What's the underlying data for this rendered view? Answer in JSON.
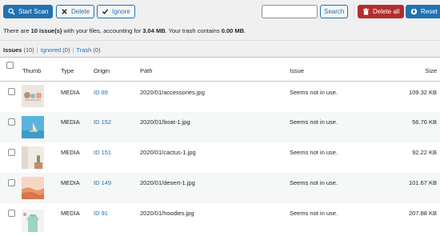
{
  "toolbar": {
    "start_scan_label": "Start Scan",
    "delete_label": "Delete",
    "ignore_label": "Ignore",
    "search_value": "",
    "search_button_label": "Search",
    "delete_all_label": "Delete all",
    "reset_label": "Reset"
  },
  "summary": {
    "prefix": "There are ",
    "issue_count": "10 issue(s)",
    "middle": " with your files, accounting for ",
    "size": "3.04 MB",
    "trash_text": ". Your trash contains ",
    "trash_size": "0.00 MB",
    "suffix": "."
  },
  "filters": {
    "issues_label": "Issues",
    "issues_count": "(10)",
    "ignored_label": "Ignored",
    "ignored_count": "(0)",
    "trash_label": "Trash",
    "trash_count": "(0)",
    "separator": "|"
  },
  "table": {
    "headers": {
      "thumb": "Thumb",
      "type": "Type",
      "origin": "Origin",
      "path": "Path",
      "issue": "Issue",
      "size": "Size"
    },
    "rows": [
      {
        "type": "MEDIA",
        "origin": "ID 89",
        "path": "2020/01/accessories.jpg",
        "issue": "Seems not in use.",
        "size": "109.32 KB",
        "thumb_icon": "accessories-thumbnail"
      },
      {
        "type": "MEDIA",
        "origin": "ID 152",
        "path": "2020/01/boat-1.jpg",
        "issue": "Seems not in use.",
        "size": "56.76 KB",
        "thumb_icon": "boat-thumbnail"
      },
      {
        "type": "MEDIA",
        "origin": "ID 151",
        "path": "2020/01/cactus-1.jpg",
        "issue": "Seems not in use.",
        "size": "92.22 KB",
        "thumb_icon": "cactus-thumbnail"
      },
      {
        "type": "MEDIA",
        "origin": "ID 149",
        "path": "2020/01/desert-1.jpg",
        "issue": "Seems not in use.",
        "size": "101.67 KB",
        "thumb_icon": "desert-thumbnail"
      },
      {
        "type": "MEDIA",
        "origin": "ID 91",
        "path": "2020/01/hoodies.jpg",
        "issue": "Seems not in use.",
        "size": "207.88 KB",
        "thumb_icon": "hoodies-thumbnail"
      }
    ]
  },
  "colors": {
    "accent": "#2271b1",
    "danger": "#b32d2e",
    "background": "#f0f0f1"
  }
}
